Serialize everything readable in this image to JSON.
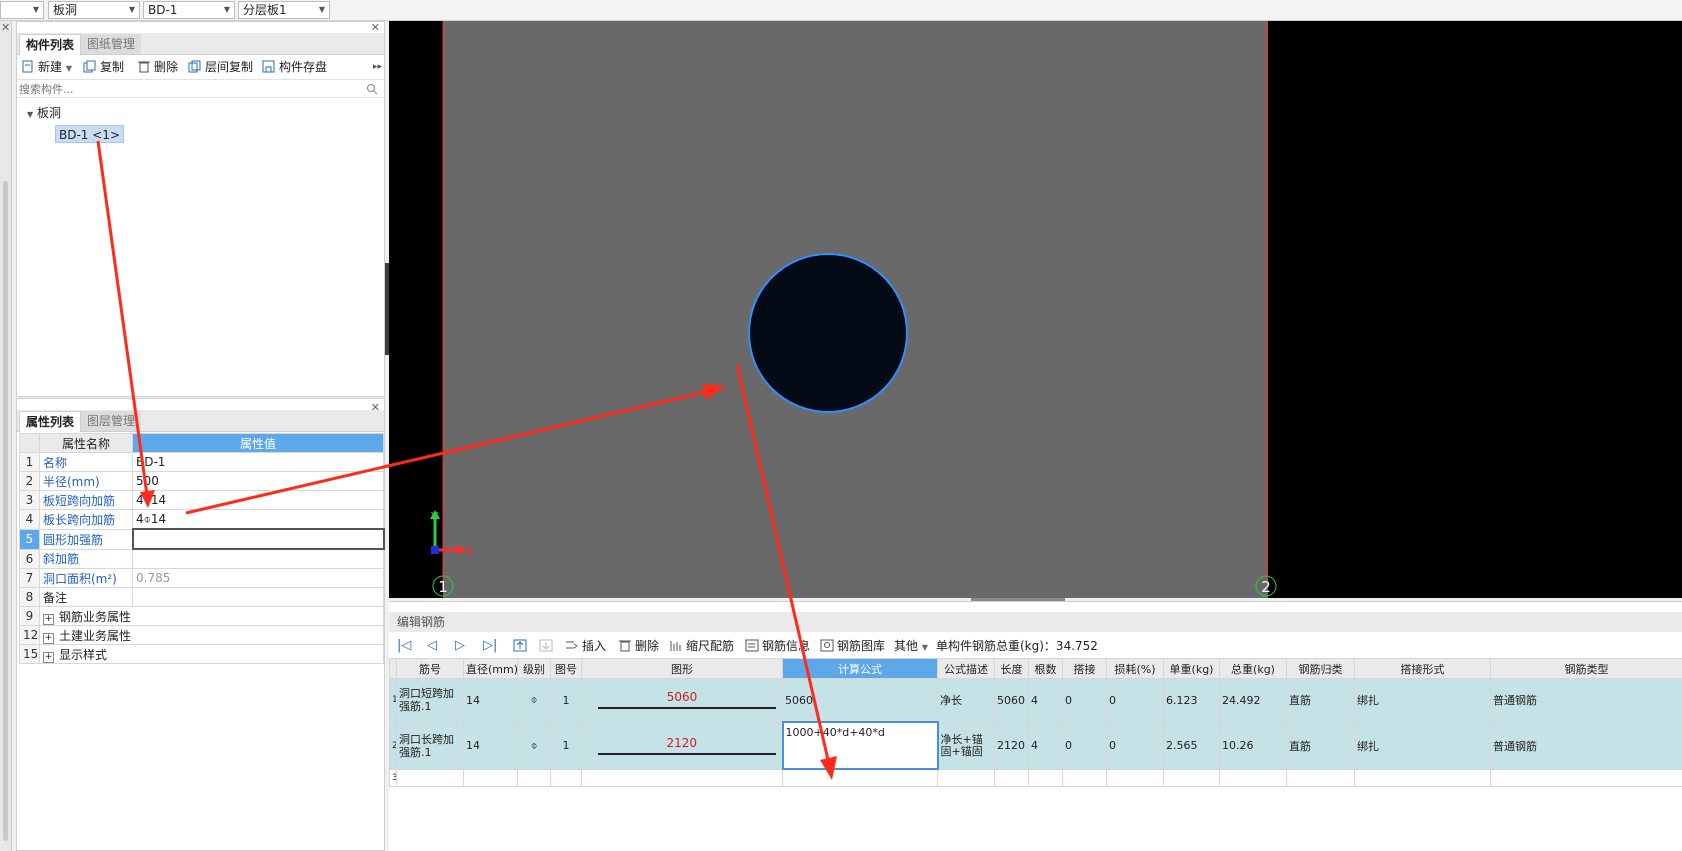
{
  "topbar": {
    "dropdowns": [
      {
        "value": ""
      },
      {
        "value": "板洞"
      },
      {
        "value": "BD-1"
      },
      {
        "value": "分层板1"
      }
    ]
  },
  "component_panel": {
    "tabs": [
      "构件列表",
      "图纸管理"
    ],
    "toolbar": {
      "new": "新建",
      "copy": "复制",
      "delete": "删除",
      "floor_copy": "层间复制",
      "save": "构件存盘"
    },
    "search_placeholder": "搜索构件...",
    "tree": {
      "group": "板洞",
      "item": "BD-1 <1>"
    }
  },
  "property_panel": {
    "tabs": [
      "属性列表",
      "图层管理"
    ],
    "headers": {
      "name": "属性名称",
      "value": "属性值"
    },
    "rows": [
      {
        "num": "1",
        "name": "名称",
        "value": "BD-1"
      },
      {
        "num": "2",
        "name": "半径(mm)",
        "value": "500"
      },
      {
        "num": "3",
        "name": "板短跨向加筋",
        "value": "4⌽14"
      },
      {
        "num": "4",
        "name": "板长跨向加筋",
        "value": "4⌽14"
      },
      {
        "num": "5",
        "name": "圆形加强筋",
        "value": ""
      },
      {
        "num": "6",
        "name": "斜加筋",
        "value": ""
      },
      {
        "num": "7",
        "name": "洞口面积(m²)",
        "value": "0.785"
      },
      {
        "num": "8",
        "name": "备注",
        "value": ""
      },
      {
        "num": "9",
        "name": "钢筋业务属性",
        "value": ""
      },
      {
        "num": "12",
        "name": "土建业务属性",
        "value": ""
      },
      {
        "num": "15",
        "name": "显示样式",
        "value": ""
      }
    ]
  },
  "cad": {
    "axis_labels": {
      "x": "X",
      "y": "Y"
    },
    "grid_labels": [
      "1",
      "2"
    ],
    "colors": {
      "background": "#000000",
      "slab": "#696969",
      "hole_fill": "#050b16",
      "hole_stroke": "#2f8fff",
      "grid_line": "#ff2a2a"
    }
  },
  "rebar_panel": {
    "title": "编辑钢筋",
    "toolbar": {
      "insert": "插入",
      "delete": "删除",
      "scale": "缩尺配筋",
      "info": "钢筋信息",
      "library": "钢筋图库",
      "other": "其他"
    },
    "total_label": "单构件钢筋总重(kg)：34.752",
    "headers": [
      "筋号",
      "直径(mm)",
      "级别",
      "图号",
      "图形",
      "计算公式",
      "公式描述",
      "长度",
      "根数",
      "搭接",
      "损耗(%)",
      "单重(kg)",
      "总重(kg)",
      "钢筋归类",
      "搭接形式",
      "钢筋类型"
    ],
    "rows": [
      {
        "num": "1",
        "name": "洞口短跨加强筋.1",
        "dia": "14",
        "grade": "⌽",
        "fig": "1",
        "shape": "5060",
        "formula": "5060",
        "desc": "净长",
        "length": "5060",
        "count": "4",
        "lap": "0",
        "loss": "0",
        "unit_w": "6.123",
        "total_w": "24.492",
        "cat": "直筋",
        "lap_type": "绑扎",
        "type": "普通钢筋"
      },
      {
        "num": "2",
        "name": "洞口长跨加强筋.1",
        "dia": "14",
        "grade": "⌽",
        "fig": "1",
        "shape": "2120",
        "formula": "1000+40*d+40*d",
        "desc": "净长+锚固+锚固",
        "length": "2120",
        "count": "4",
        "lap": "0",
        "loss": "0",
        "unit_w": "2.565",
        "total_w": "10.26",
        "cat": "直筋",
        "lap_type": "绑扎",
        "type": "普通钢筋"
      },
      {
        "num": "3"
      }
    ]
  },
  "annotation_color": "#ff2a1a"
}
